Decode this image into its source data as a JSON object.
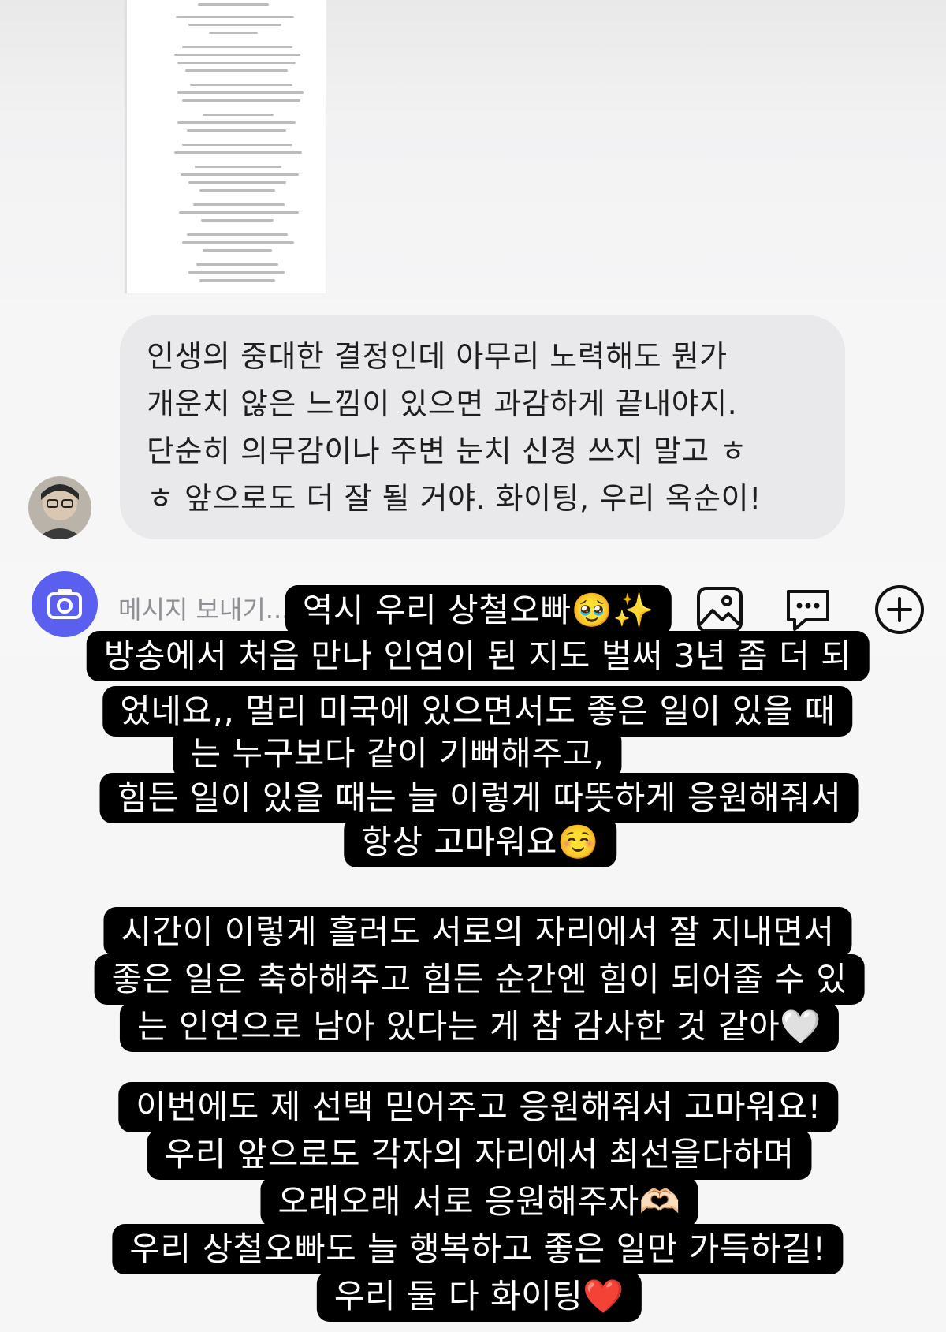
{
  "message": {
    "lines": [
      "인생의 중대한 결정인데 아무리 노력해도 뭔가",
      "개운치 않은 느낌이 있으면 과감하게 끝내야지.",
      "단순히 의무감이나 주변 눈치 신경 쓰지 말고 ㅎ",
      "ㅎ 앞으로도 더 잘 될 거야. 화이팅, 우리 옥순이!"
    ]
  },
  "composer": {
    "placeholder": "메시지 보내기..."
  },
  "story_text": {
    "line1": "역시 우리 상철오빠🥹✨",
    "line2": "방송에서 처음 만나 인연이 된 지도 벌써 3년 좀 더 되",
    "line3": "었네요,, 멀리 미국에 있으면서도 좋은 일이 있을 때",
    "line4": "는 누구보다 같이 기뻐해주고,",
    "line5": "힘든 일이 있을 때는 늘 이렇게 따뜻하게 응원해줘서",
    "line6": "항상 고마워요☺️",
    "line7": "시간이 이렇게 흘러도 서로의 자리에서 잘 지내면서",
    "line8": "좋은 일은 축하해주고 힘든 순간엔 힘이 되어줄 수 있",
    "line9": "는 인연으로 남아 있다는 게 참 감사한 것 같아🤍",
    "line10": "이번에도 제 선택 믿어주고 응원해줘서 고마워요!",
    "line11": "우리 앞으로도 각자의 자리에서 최선을다하며",
    "line12": "오래오래 서로 응원해주자🫶🏻",
    "line13": "우리 상철오빠도 늘 행복하고 좋은 일만 가득하길!",
    "line14": "우리 둘 다 화이팅❤️"
  },
  "colors": {
    "camera_button": "#5b5ff0",
    "bubble": "#e9e9ec",
    "overlay": "#000000"
  },
  "icons": [
    "camera-icon",
    "gallery-icon",
    "chat-icon",
    "add-icon"
  ]
}
